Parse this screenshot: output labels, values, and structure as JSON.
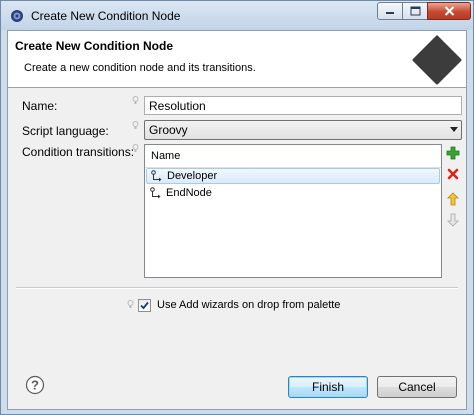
{
  "window": {
    "title": "Create New Condition Node"
  },
  "header": {
    "title": "Create New Condition Node",
    "description": "Create a new condition node and its transitions.",
    "logo_icon": "diamond-node-icon"
  },
  "form": {
    "name_label": "Name:",
    "name_value": "Resolution",
    "script_language_label": "Script language:",
    "script_language_value": "Groovy",
    "condition_transitions_label": "Condition transitions:"
  },
  "transitions": {
    "column_header": "Name",
    "rows": [
      {
        "label": "Developer",
        "selected": true,
        "icon": "transition-icon"
      },
      {
        "label": "EndNode",
        "selected": false,
        "icon": "transition-icon"
      }
    ],
    "actions": {
      "add_icon": "add-icon",
      "remove_icon": "remove-icon",
      "move_up_icon": "move-up-icon",
      "move_down_icon": "move-down-icon"
    }
  },
  "options": {
    "use_wizards_label": "Use Add wizards on drop from palette",
    "use_wizards_checked": true
  },
  "footer": {
    "help_icon": "help-icon",
    "finish_label": "Finish",
    "cancel_label": "Cancel"
  },
  "colors": {
    "title_bar": "#c2d4e8",
    "close_button": "#c84a33",
    "selection": "#dbeafc",
    "add_green": "#3aa335",
    "remove_red": "#d7261e",
    "arrow_up": "#e8b21c",
    "logo": "#3c3c3c"
  }
}
